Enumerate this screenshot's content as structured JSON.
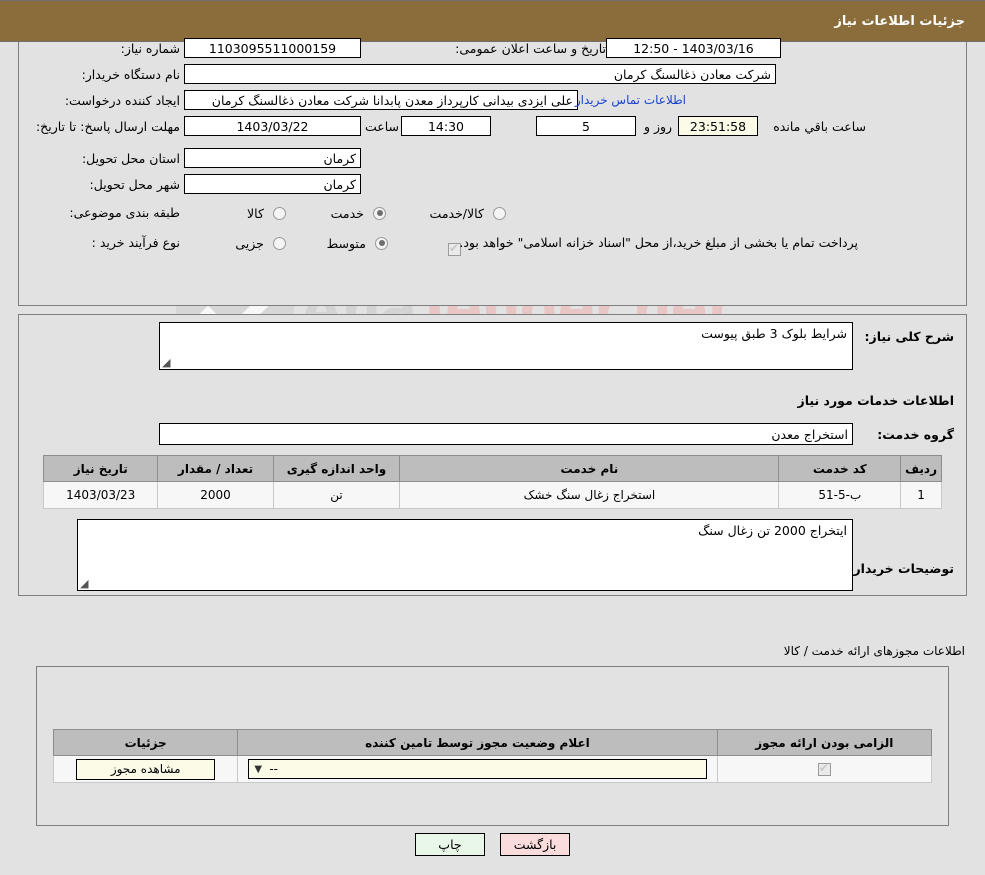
{
  "header": {
    "title": "جزئیات اطلاعات نیاز"
  },
  "fields": {
    "need_number_label": "شماره نیاز:",
    "need_number_value": "1103095511000159",
    "announce_label": "تاریخ و ساعت اعلان عمومی:",
    "announce_value": "1403/03/16 - 12:50",
    "buyer_org_label": "نام دستگاه خریدار:",
    "buyer_org_value": "شرکت معادن ذغالسنگ کرمان",
    "creator_label": "ایجاد کننده درخواست:",
    "creator_value": "علی ایزدی بیدانی کارپرداز معدن پابدانا شرکت معادن ذغالسنگ کرمان",
    "contact_link": "اطلاعات تماس خریدار",
    "deadline_label": "مهلت ارسال پاسخ: تا تاریخ:",
    "deadline_date": "1403/03/22",
    "time_label": "ساعت",
    "deadline_time": "14:30",
    "days_value": "5",
    "days_sep_label": "روز و",
    "countdown_value": "23:51:58",
    "remaining_label": "ساعت باقي مانده",
    "province_label": "استان محل تحویل:",
    "province_value": "کرمان",
    "city_label": "شهر محل تحویل:",
    "city_value": "کرمان",
    "category_label": "طبقه بندی موضوعی:",
    "process_label": "نوع فرآیند خرید :",
    "payment_note": "پرداخت تمام یا بخشی از مبلغ خرید،از محل \"اسناد خزانه اسلامی\" خواهد بود."
  },
  "category_options": [
    {
      "label": "کالا",
      "selected": false
    },
    {
      "label": "خدمت",
      "selected": true
    },
    {
      "label": "کالا/خدمت",
      "selected": false
    }
  ],
  "process_options": [
    {
      "label": "جزیی",
      "selected": false
    },
    {
      "label": "متوسط",
      "selected": true
    }
  ],
  "payment_checkbox_checked": true,
  "description": {
    "label": "شرح کلی نیاز:",
    "value": "شرایط بلوک 3 طبق پیوست"
  },
  "services_section": {
    "title": "اطلاعات خدمات مورد نیاز",
    "group_label": "گروه خدمت:",
    "group_value": "استخراج معدن"
  },
  "services_table": {
    "columns": [
      "ردیف",
      "کد خدمت",
      "نام خدمت",
      "واحد اندازه گیری",
      "تعداد / مقدار",
      "تاریخ نیاز"
    ],
    "rows": [
      [
        "1",
        "ب-5-51",
        "استخراج زغال سنگ خشک",
        "تن",
        "2000",
        "1403/03/23"
      ]
    ]
  },
  "buyer_notes": {
    "label": "توضیحات خریدار:",
    "value": "ایتخراج 2000 تن زغال سنگ"
  },
  "permits": {
    "outside_title": "اطلاعات مجوزهای ارائه خدمت / کالا",
    "columns": [
      "الزامی بودن ارائه مجوز",
      "اعلام وضعیت مجوز توسط تامین کننده",
      "جزئیات"
    ],
    "rows": [
      {
        "required_checked": true,
        "status_value": "--",
        "detail_button": "مشاهده مجوز"
      }
    ]
  },
  "footer": {
    "print_label": "چاپ",
    "back_label": "بازگشت"
  },
  "watermark": {
    "brand_left": "Ana",
    "brand_right": "Tender.net"
  },
  "colors": {
    "titlebar": "#8a6d3b",
    "link": "#1a44d0",
    "header_row": "#bdbdbd",
    "cream": "#fbfbe8",
    "print_btn": "#e9f7e9",
    "back_btn": "#fbdcdc"
  }
}
